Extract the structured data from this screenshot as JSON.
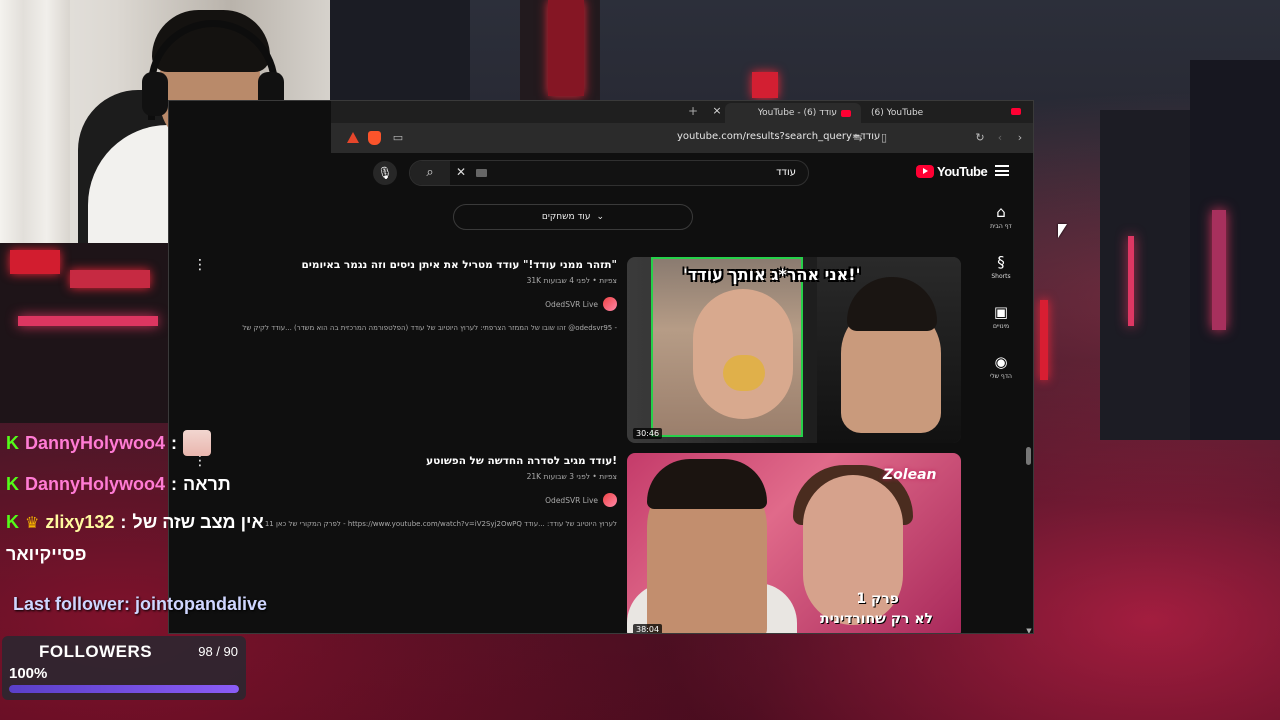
{
  "browser": {
    "tabs": [
      {
        "title": "YouTube - עודד (6)",
        "active": true
      },
      {
        "title": "(6) YouTube",
        "active": false
      }
    ],
    "new_tab_label": "+",
    "close_tab_label": "×",
    "url": "youtube.com/results?search_query=עודד"
  },
  "youtube": {
    "logo_text": "YouTube",
    "search_query": "עודד",
    "more_games_label": "עוד משחקים",
    "sidebar": [
      {
        "icon": "home-icon",
        "glyph": "⌂",
        "label": "דף הבית"
      },
      {
        "icon": "shorts-icon",
        "glyph": "§",
        "label": "Shorts"
      },
      {
        "icon": "subscriptions-icon",
        "glyph": "▣",
        "label": "מינויים"
      },
      {
        "icon": "profile-icon",
        "glyph": "◉",
        "label": "הדף שלי"
      }
    ],
    "results": [
      {
        "title": "תזהר ממני עודד!\" עודד מטריל את איתן ניסים וזה נגמר באיומים\"",
        "meta": "31K צפיות • לפני 4 שבועות",
        "channel": "OdedSVR Live",
        "description": "זהו שובו של הממזר הצרפתי: לערוץ היוטיוב של עודד (הפלטפורמה המרכזית בה הוא משדר) ...עודד לקיק של @odedsvr95 -",
        "duration": "30:46",
        "thumb_text": "'אני אהר*ג אותך עודד!'"
      },
      {
        "title": "עודד מגיב לסדרה החדשה של הפשוטע!",
        "meta": "21K צפיות • לפני 3 שבועות",
        "channel": "OdedSVR Live",
        "description": "לפרק המקורי של כאן 11 - https://www.youtube.com/watch?v=iV2Syj2OwPQ לערוץ היוטיוב של עודד: ...עודד",
        "duration": "38:04",
        "thumb_logo": "Zolean",
        "thumb_episode": "פרק 1",
        "thumb_subtitle": "לא רק שחורדינית"
      }
    ]
  },
  "chat": [
    {
      "badges": [
        "K"
      ],
      "user": "DannyHolywoo4",
      "message": "",
      "has_emote": true,
      "color": "#ff7bd4"
    },
    {
      "badges": [
        "K"
      ],
      "user": "DannyHolywoo4",
      "message": "תראה",
      "has_emote": false,
      "color": "#ff7bd4"
    },
    {
      "badges": [
        "K",
        "crown"
      ],
      "user": "zlixy132",
      "message": "אין מצב שזה של",
      "has_emote": false,
      "color": "#fffaa0"
    }
  ],
  "chat_wrap": "פסייקיואר",
  "last_follower": "Last follower: jointopandalive",
  "followers_goal": {
    "title": "FOLLOWERS",
    "count": "98 / 90",
    "percent_label": "100%",
    "progress": 1.0
  }
}
